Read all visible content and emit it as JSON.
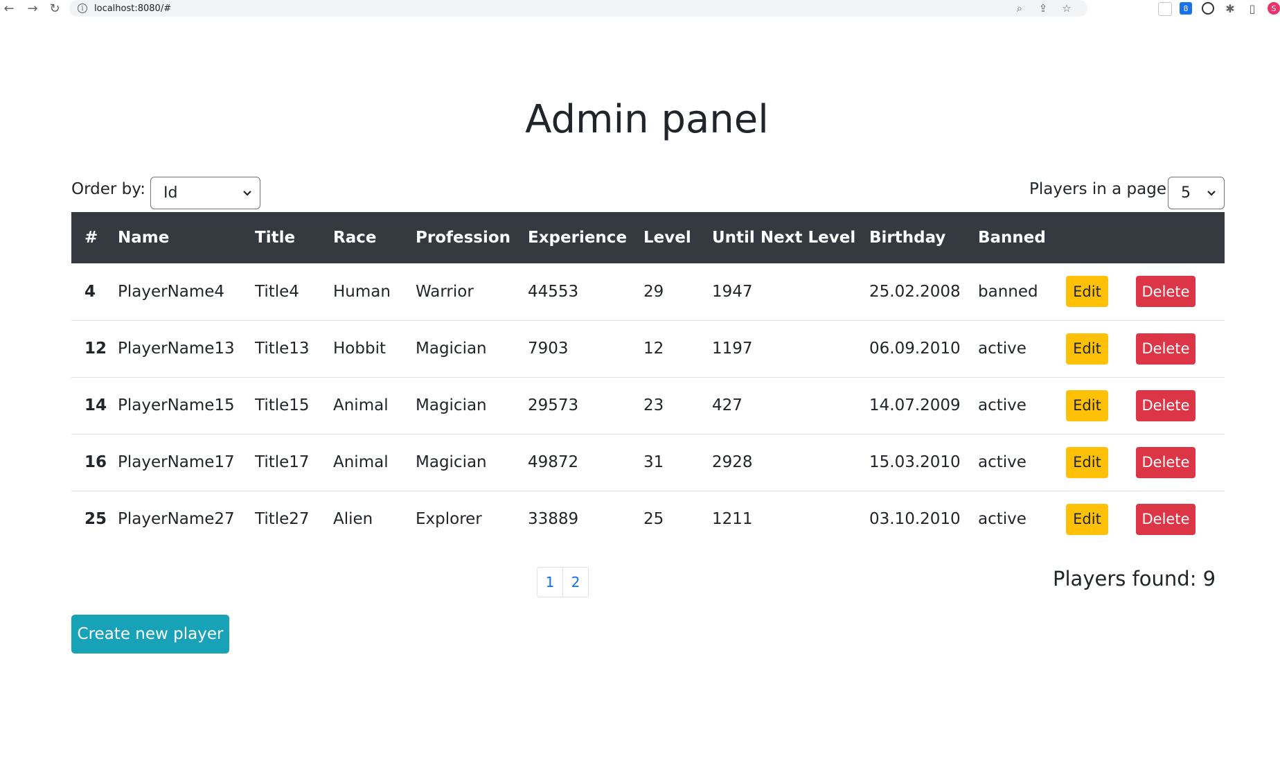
{
  "browser": {
    "url": "localhost:8080/#",
    "profile_initial": "S"
  },
  "page": {
    "title": "Admin panel",
    "order_label": "Order by:",
    "order_value": "Id",
    "players_per_page_label": "Players in a page:",
    "players_per_page_value": "5",
    "players_found": "Players found: 9",
    "create_button": "Create new player"
  },
  "table": {
    "headers": [
      "#",
      "Name",
      "Title",
      "Race",
      "Profession",
      "Experience",
      "Level",
      "Until Next Level",
      "Birthday",
      "Banned"
    ],
    "rows": [
      {
        "id": "4",
        "name": "PlayerName4",
        "title": "Title4",
        "race": "Human",
        "profession": "Warrior",
        "experience": "44553",
        "level": "29",
        "until_next": "1947",
        "birthday": "25.02.2008",
        "banned": "banned"
      },
      {
        "id": "12",
        "name": "PlayerName13",
        "title": "Title13",
        "race": "Hobbit",
        "profession": "Magician",
        "experience": "7903",
        "level": "12",
        "until_next": "1197",
        "birthday": "06.09.2010",
        "banned": "active"
      },
      {
        "id": "14",
        "name": "PlayerName15",
        "title": "Title15",
        "race": "Animal",
        "profession": "Magician",
        "experience": "29573",
        "level": "23",
        "until_next": "427",
        "birthday": "14.07.2009",
        "banned": "active"
      },
      {
        "id": "16",
        "name": "PlayerName17",
        "title": "Title17",
        "race": "Animal",
        "profession": "Magician",
        "experience": "49872",
        "level": "31",
        "until_next": "2928",
        "birthday": "15.03.2010",
        "banned": "active"
      },
      {
        "id": "25",
        "name": "PlayerName27",
        "title": "Title27",
        "race": "Alien",
        "profession": "Explorer",
        "experience": "33889",
        "level": "25",
        "until_next": "1211",
        "birthday": "03.10.2010",
        "banned": "active"
      }
    ],
    "edit_label": "Edit",
    "delete_label": "Delete"
  },
  "pagination": {
    "pages": [
      "1",
      "2"
    ]
  },
  "colors": {
    "header_bg": "#343a40",
    "edit": "#ffc107",
    "delete": "#dc3545",
    "create": "#17a2b8",
    "link": "#0d6efd"
  },
  "icons": [
    "back-arrow-icon",
    "forward-arrow-icon",
    "reload-icon",
    "info-icon",
    "zoom-icon",
    "share-icon",
    "star-icon",
    "extensions-icon",
    "sidebar-icon",
    "chevron-down-icon"
  ]
}
